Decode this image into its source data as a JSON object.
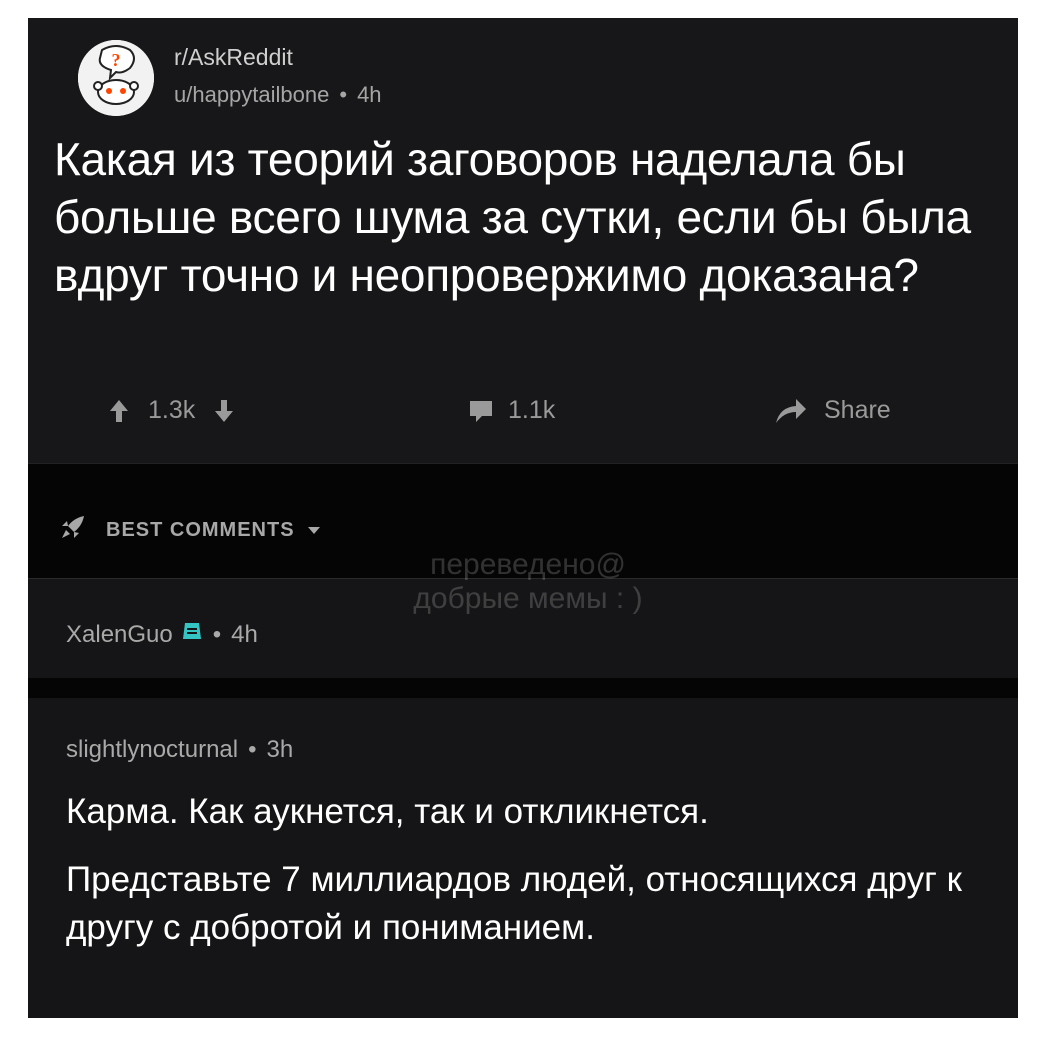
{
  "post": {
    "subreddit": "r/AskReddit",
    "author": "u/happytailbone",
    "time": "4h",
    "title": "Какая из теорий заговоров наделала бы больше всего шума за сутки, если бы была вдруг точно и неопровержимо доказана?",
    "votes": "1.3k",
    "comments": "1.1k",
    "share_label": "Share"
  },
  "sort": {
    "label": "BEST COMMENTS"
  },
  "watermark": {
    "line1": "переведено@",
    "line2": "добрые мемы : )"
  },
  "comments": [
    {
      "author": "XalenGuo",
      "time": "4h"
    },
    {
      "author": "slightlynocturnal",
      "time": "3h",
      "paragraph1": "Карма. Как аукнется, так и откликнется.",
      "paragraph2": "Представьте 7 миллиардов людей, относящихся друг к другу с добротой и пониманием."
    }
  ],
  "colors": {
    "background": "#151517",
    "text": "#ffffff",
    "muted": "#a9a9a9",
    "flair": "#35c4c4"
  }
}
